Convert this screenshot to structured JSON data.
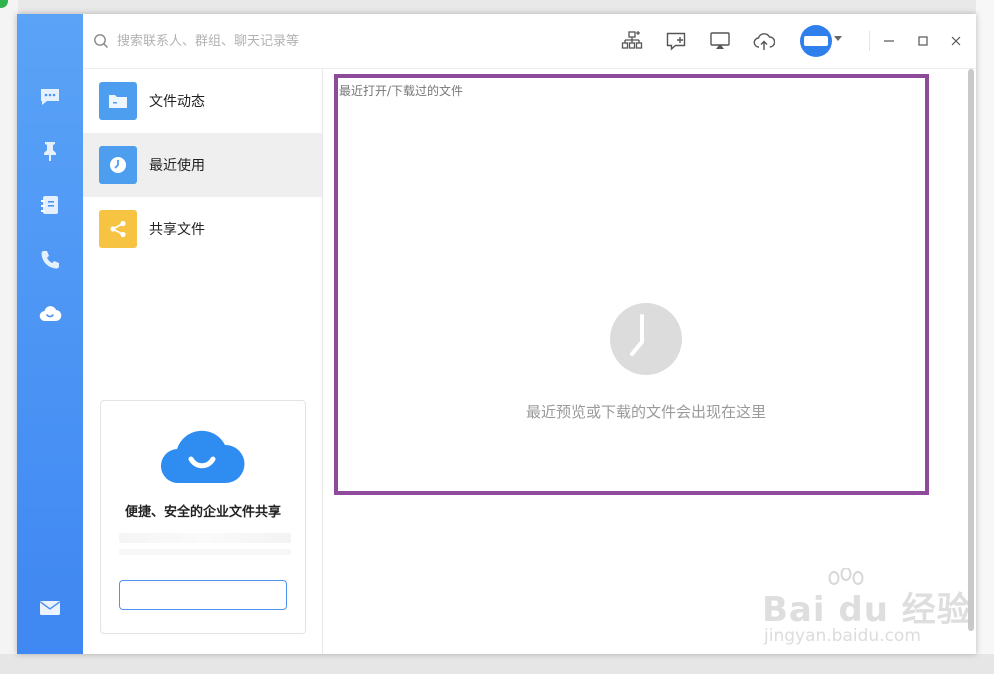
{
  "search": {
    "placeholder": "搜索联系人、群组、聊天记录等"
  },
  "toolbar": {
    "icons": [
      "org-chart-icon",
      "new-chat-icon",
      "screen-cast-icon",
      "cloud-upload-icon"
    ]
  },
  "rail": {
    "items": [
      "chat-bubble-icon",
      "pin-icon",
      "contacts-book-icon",
      "phone-icon",
      "cloud-drive-icon"
    ],
    "bottom": "mail-icon"
  },
  "file_nav": {
    "items": [
      {
        "label": "文件动态",
        "icon": "folder-icon",
        "color": "#4e9ef0"
      },
      {
        "label": "最近使用",
        "icon": "clock-icon",
        "color": "#4e9ef0",
        "active": true
      },
      {
        "label": "共享文件",
        "icon": "share-icon",
        "color": "#f6c343"
      }
    ]
  },
  "promo": {
    "title": "便捷、安全的企业文件共享"
  },
  "main": {
    "caption": "最近打开/下载过的文件",
    "empty_text": "最近预览或下载的文件会出现在这里"
  },
  "watermark": {
    "brand": "Bai du 经验",
    "url": "jingyan.baidu.com"
  },
  "colors": {
    "rail_top": "#5aa3f7",
    "rail_bottom": "#3f87f2",
    "highlight_border": "#8e4b9b",
    "accent": "#2f80ed"
  }
}
